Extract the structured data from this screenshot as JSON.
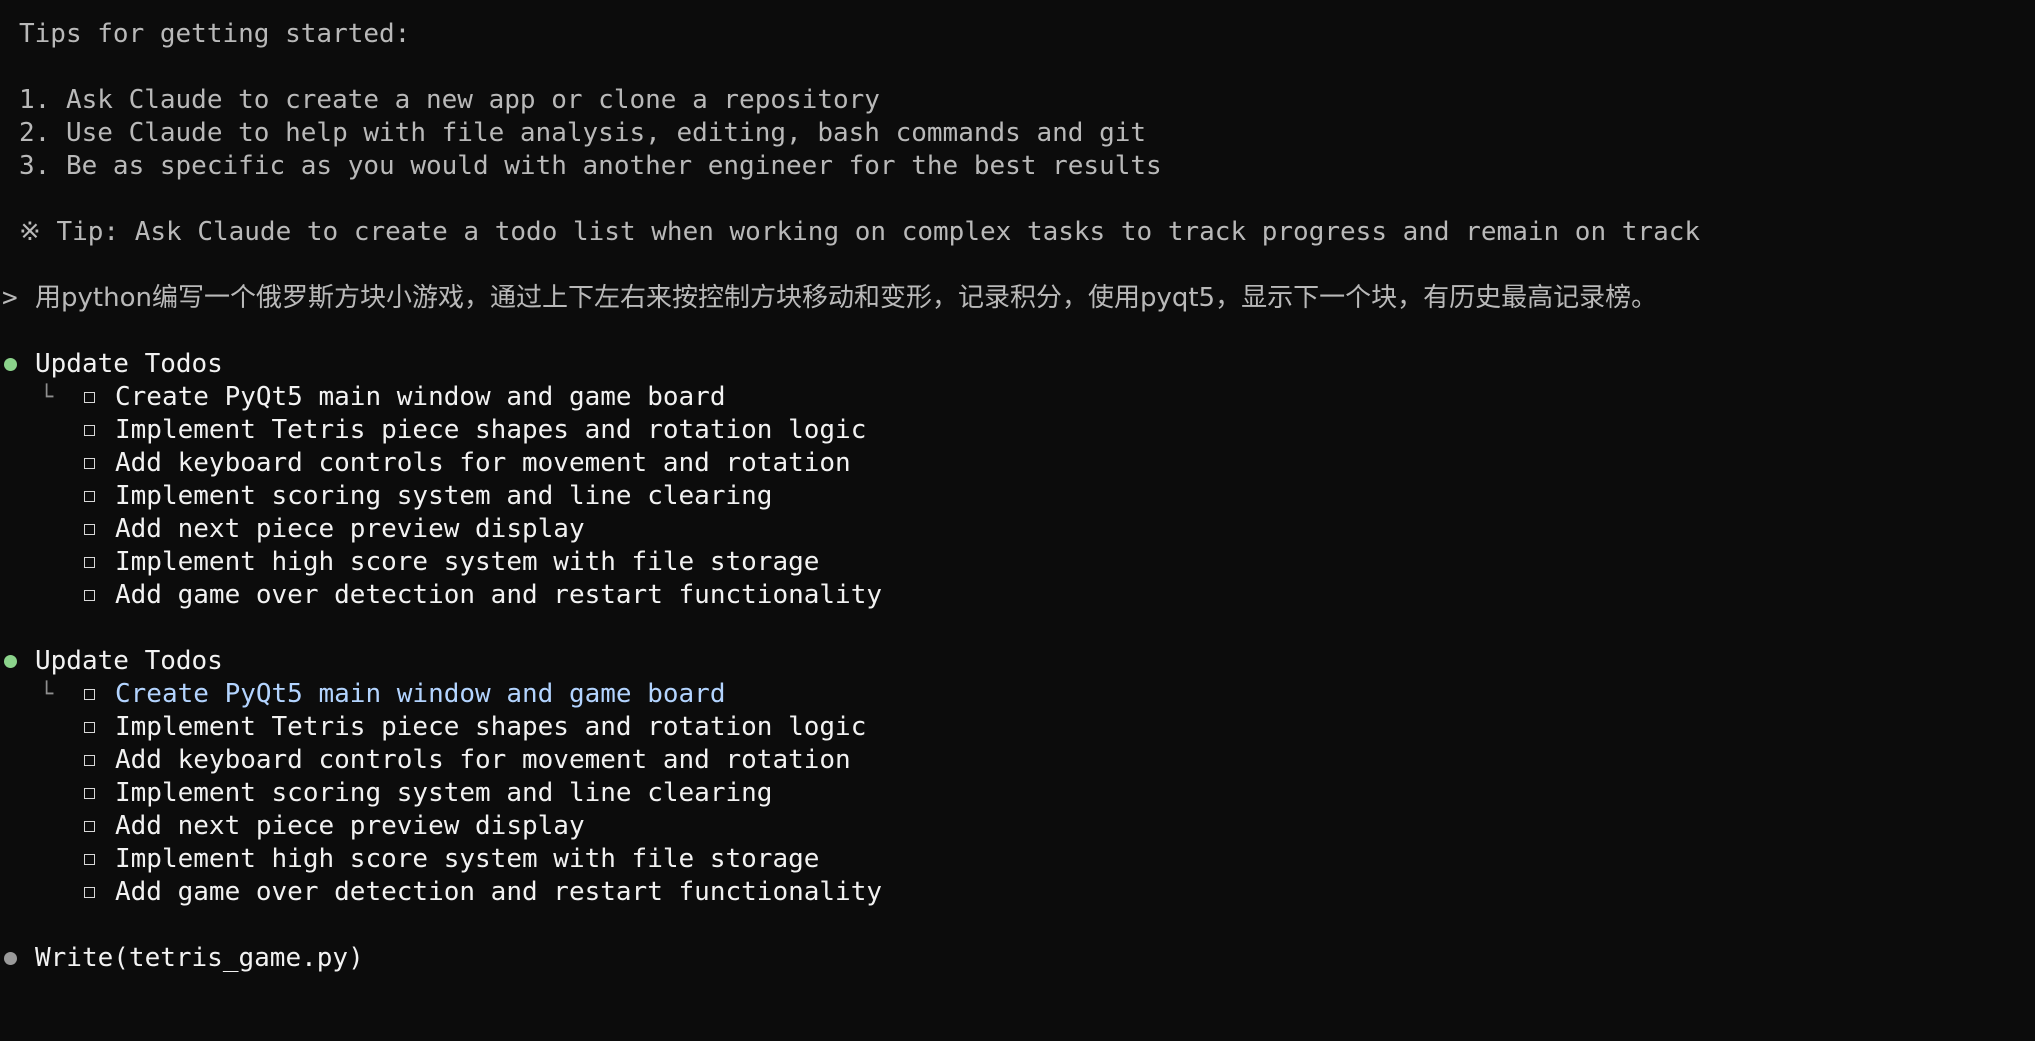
{
  "tips": {
    "heading": "Tips for getting started:",
    "items": [
      "1. Ask Claude to create a new app or clone a repository",
      "2. Use Claude to help with file analysis, editing, bash commands and git",
      "3. Be as specific as you would with another engineer for the best results"
    ],
    "tip_line": "※ Tip: Ask Claude to create a todo list when working on complex tasks to track progress and remain on track"
  },
  "prompt": {
    "symbol": ">",
    "text": "用python编写一个俄罗斯方块小游戏，通过上下左右来按控制方块移动和变形，记录积分，使用pyqt5，显示下一个块，有历史最高记录榜。"
  },
  "todo_blocks": [
    {
      "title": "Update Todos",
      "tree_glyph": "└",
      "items": [
        "Create PyQt5 main window and game board",
        "Implement Tetris piece shapes and rotation logic",
        "Add keyboard controls for movement and rotation",
        "Implement scoring system and line clearing",
        "Add next piece preview display",
        "Implement high score system with file storage",
        "Add game over detection and restart functionality"
      ]
    },
    {
      "title": "Update Todos",
      "tree_glyph": "└",
      "items": [
        "Create PyQt5 main window and game board",
        "Implement Tetris piece shapes and rotation logic",
        "Add keyboard controls for movement and rotation",
        "Implement scoring system and line clearing",
        "Add next piece preview display",
        "Implement high score system with file storage",
        "Add game over detection and restart functionality"
      ]
    }
  ],
  "write_action": {
    "text": "Write(tetris_game.py)"
  },
  "colors": {
    "background": "#0c0c0c",
    "dim_text": "#b9b9b9",
    "bright_text": "#f2f2f2",
    "active_item": "#b3d4ff",
    "done_bullet": "#8bd38b",
    "pending_bullet": "#9a9a9a"
  }
}
